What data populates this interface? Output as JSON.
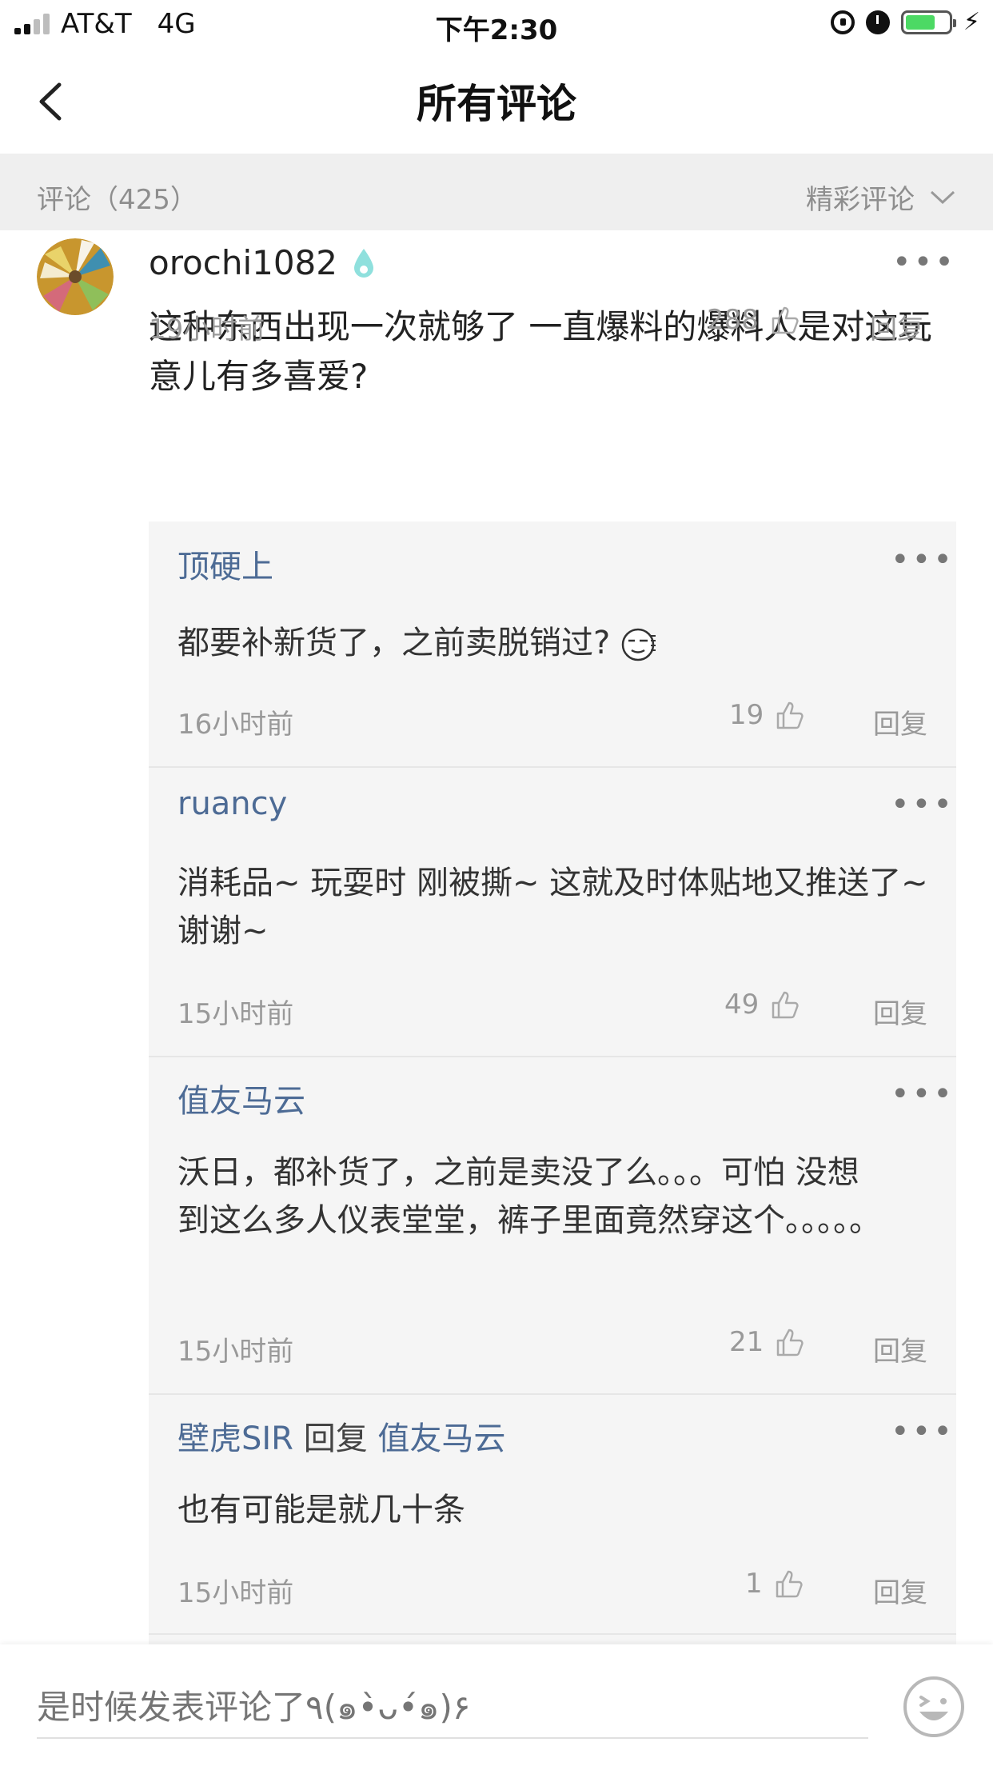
{
  "status_bar": {
    "carrier": "AT&T",
    "network": "4G",
    "time": "下午2:30"
  },
  "nav": {
    "title": "所有评论"
  },
  "section": {
    "count_label": "评论（425）",
    "sort_label": "精彩评论"
  },
  "main_comment": {
    "username": "orochi1082",
    "text": "这种东西出现一次就够了 一直爆料的爆料人是对这玩意儿有多喜爱?",
    "time": "19小时前",
    "likes": "288",
    "reply_label": "回复"
  },
  "replies": [
    {
      "author": "顶硬上",
      "reply_to_word": "",
      "reply_to": "",
      "text": "都要补新货了，之前卖脱销过?",
      "time": "16小时前",
      "likes": "19",
      "reply_label": "回复"
    },
    {
      "author": "ruancy",
      "reply_to_word": "",
      "reply_to": "",
      "text": "消耗品~ 玩耍时 刚被撕~ 这就及时体贴地又推送了~ 谢谢~",
      "time": "15小时前",
      "likes": "49",
      "reply_label": "回复"
    },
    {
      "author": "值友马云",
      "reply_to_word": "",
      "reply_to": "",
      "text": "沃日，都补货了，之前是卖没了么。。。可怕 没想到这么多人仪表堂堂，裤子里面竟然穿这个。。。。。",
      "time": "15小时前",
      "likes": "21",
      "reply_label": "回复"
    },
    {
      "author": "壁虎SIR",
      "reply_to_word": "回复",
      "reply_to": "值友马云",
      "text": "也有可能是就几十条",
      "time": "15小时前",
      "likes": "1",
      "reply_label": "回复"
    }
  ],
  "bottom_bar": {
    "input_placeholder": "是时候发表评论了٩(๑•̀ᴗ•́๑)۶"
  },
  "colors": {
    "link_blue": "#4d6b95",
    "battery_green": "#4cd964",
    "section_bg": "#efefef",
    "reply_bg": "#f5f5f5"
  },
  "icons": [
    "signal-icon",
    "orientation-lock-icon",
    "alarm-icon",
    "battery-icon",
    "charging-icon",
    "back-chevron-icon",
    "chevron-down-icon",
    "level-drop-icon",
    "more-dots-icon",
    "thumbs-up-icon",
    "meme-face-icon",
    "emoji-face-icon"
  ]
}
